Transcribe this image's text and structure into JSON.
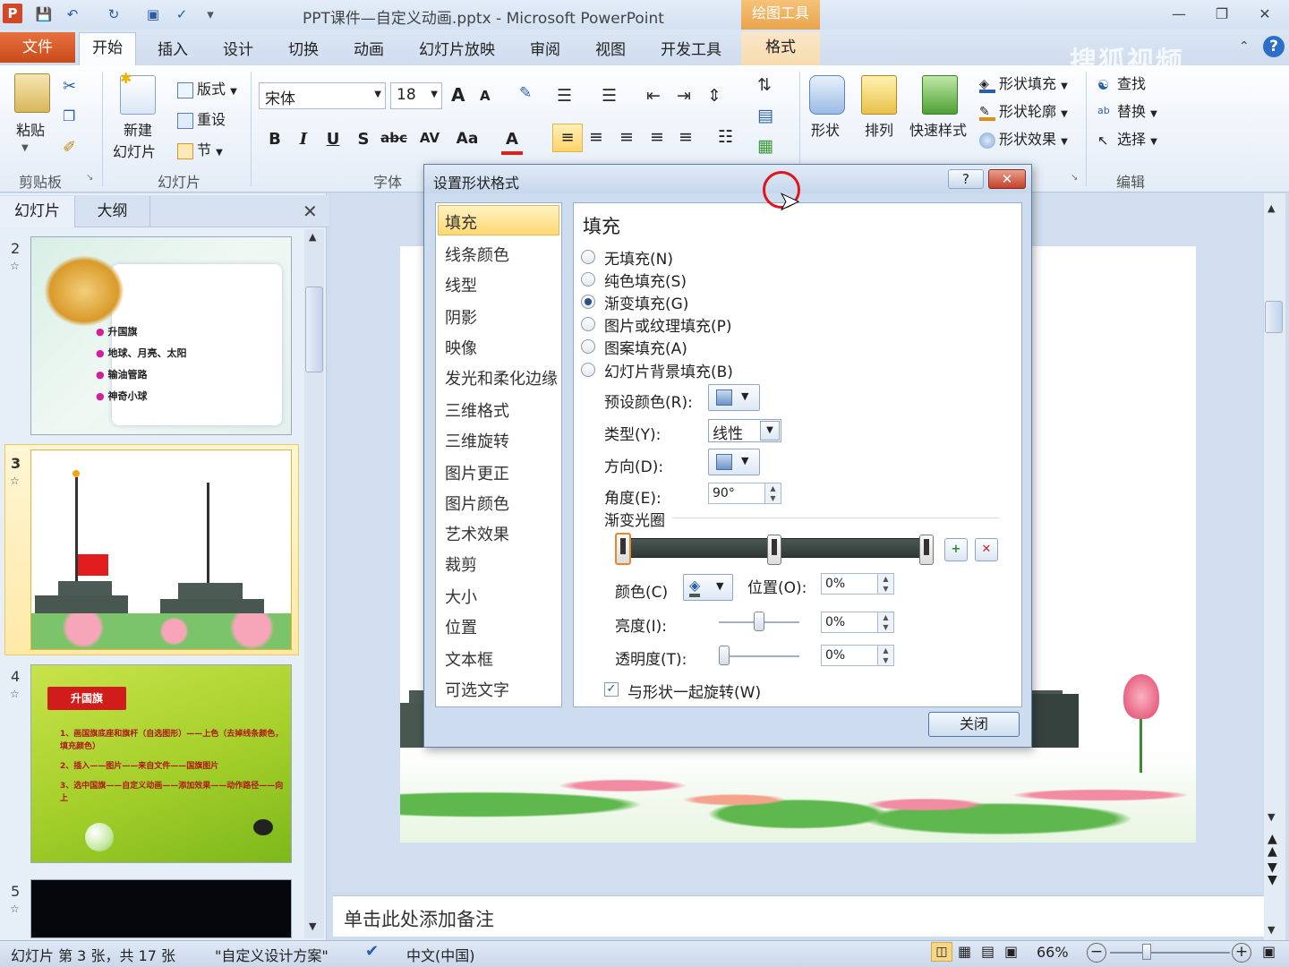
{
  "window": {
    "title": "PPT课件—自定义动画.pptx - Microsoft PowerPoint",
    "context_tab_group": "绘图工具",
    "watermark": "搜狐视频"
  },
  "tabs": [
    "文件",
    "开始",
    "插入",
    "设计",
    "切换",
    "动画",
    "幻灯片放映",
    "审阅",
    "视图",
    "开发工具",
    "格式"
  ],
  "ribbon": {
    "clipboard": {
      "paste": "粘贴",
      "label": "剪贴板"
    },
    "slides": {
      "new_slide_1": "新建",
      "new_slide_2": "幻灯片",
      "layout": "版式",
      "reset": "重设",
      "section": "节",
      "label": "幻灯片"
    },
    "font": {
      "name": "宋体",
      "size": "18",
      "label": "字体",
      "bold": "B",
      "italic": "I",
      "underline": "U",
      "shadow": "S",
      "strike": "abc",
      "spacing": "AV",
      "case": "Aa",
      "color": "A",
      "grow": "A",
      "shrink": "A"
    },
    "drawing": {
      "shapes": "形状",
      "arrange": "排列",
      "quick_styles": "快速样式",
      "fill": "形状填充",
      "outline": "形状轮廓",
      "effects": "形状效果"
    },
    "editing": {
      "find": "查找",
      "replace": "替换",
      "select": "选择",
      "label": "编辑"
    }
  },
  "left_pane": {
    "tabs": [
      "幻灯片",
      "大纲"
    ],
    "slides": [
      {
        "num": "2",
        "bullets": [
          "升国旗",
          "地球、月亮、太阳",
          "输油管路",
          "神奇小球"
        ]
      },
      {
        "num": "3"
      },
      {
        "num": "4",
        "title": "升国旗",
        "lines": [
          "1、画国旗底座和旗杆（自选图形）——上色（去掉线条颜色，填充颜色）",
          "2、插入——图片——来自文件——国旗图片",
          "3、选中国旗——自定义动画——添加效果——动作路径——向上"
        ]
      },
      {
        "num": "5"
      }
    ]
  },
  "notes_placeholder": "单击此处添加备注",
  "status": {
    "slide_info": "幻灯片 第 3 张，共 17 张",
    "theme": "\"自定义设计方案\"",
    "language": "中文(中国)",
    "zoom": "66%"
  },
  "dialog": {
    "title": "设置形状格式",
    "help": "?",
    "nav": [
      "填充",
      "线条颜色",
      "线型",
      "阴影",
      "映像",
      "发光和柔化边缘",
      "三维格式",
      "三维旋转",
      "图片更正",
      "图片颜色",
      "艺术效果",
      "裁剪",
      "大小",
      "位置",
      "文本框",
      "可选文字"
    ],
    "selected_nav": "填充",
    "panel_title": "填充",
    "fill_options": [
      {
        "label": "无填充(N)",
        "checked": false
      },
      {
        "label": "纯色填充(S)",
        "checked": false
      },
      {
        "label": "渐变填充(G)",
        "checked": true
      },
      {
        "label": "图片或纹理填充(P)",
        "checked": false
      },
      {
        "label": "图案填充(A)",
        "checked": false
      },
      {
        "label": "幻灯片背景填充(B)",
        "checked": false
      }
    ],
    "preset_label": "预设颜色(R):",
    "type_label": "类型(Y):",
    "type_value": "线性",
    "direction_label": "方向(D):",
    "angle_label": "角度(E):",
    "angle_value": "90°",
    "stops_label": "渐变光圈",
    "color_label": "颜色(C)",
    "position_label": "位置(O):",
    "position_value": "0%",
    "brightness_label": "亮度(I):",
    "brightness_value": "0%",
    "brightness_level": 0.5,
    "transparency_label": "透明度(T):",
    "transparency_value": "0%",
    "transparency_level": 0,
    "rotate_with_shape": "与形状一起旋转(W)",
    "rotate_checked": true,
    "close": "关闭"
  }
}
